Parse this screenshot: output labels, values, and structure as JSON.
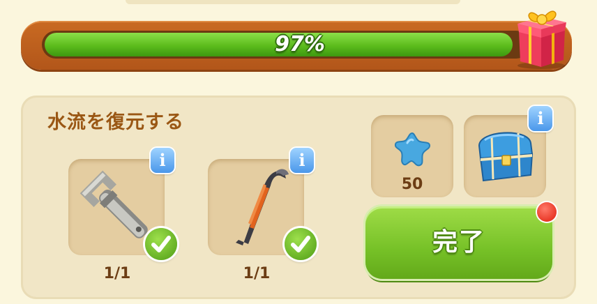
{
  "progress": {
    "percent_label": "97%",
    "value": 0.97,
    "reward_icon": "gift-box-icon"
  },
  "quest": {
    "title": "水流を復元する",
    "requirements": [
      {
        "item": "wrench",
        "icon": "wrench-icon",
        "count": "1/1",
        "completed": true
      },
      {
        "item": "crowbar",
        "icon": "crowbar-icon",
        "count": "1/1",
        "completed": true
      }
    ],
    "rewards": [
      {
        "icon": "blue-star-icon",
        "amount": "50"
      },
      {
        "icon": "treasure-chest-icon"
      }
    ],
    "complete_button_label": "完了"
  },
  "colors": {
    "bar_green": "#5cbc1c",
    "bar_frame": "#c96a22",
    "button_green": "#76c127",
    "info_blue": "#4a97ea",
    "title_brown": "#9a5714"
  }
}
